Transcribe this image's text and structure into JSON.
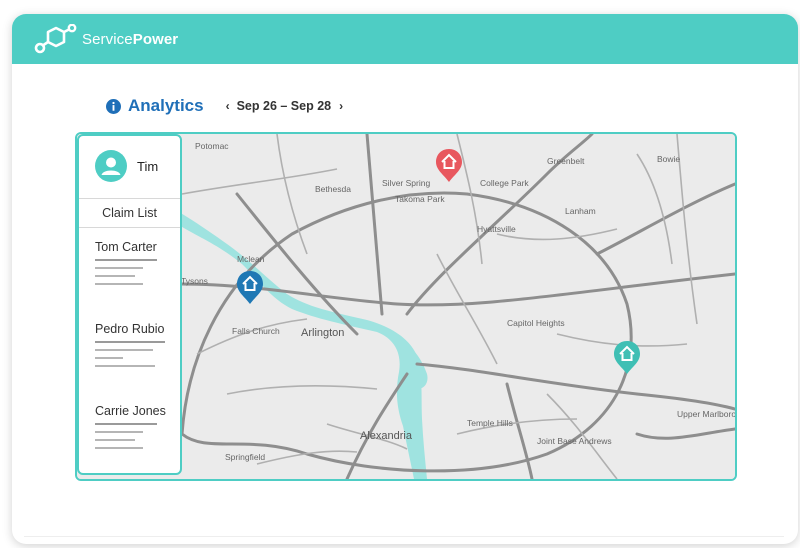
{
  "brand": {
    "prefix": "Service",
    "suffix": "Power",
    "logo_icon": "servicepower-hex-logo"
  },
  "header": {
    "title": "Analytics",
    "info_icon": "info-circle-icon",
    "prev_icon": "‹",
    "next_icon": "›",
    "date_range": "Sep 26 – Sep 28"
  },
  "sidebar": {
    "user": {
      "name": "Tim",
      "avatar_icon": "user-avatar-icon"
    },
    "list_title": "Claim List",
    "claims": [
      {
        "name": "Tom Carter"
      },
      {
        "name": "Pedro Rubio"
      },
      {
        "name": "Carrie Jones"
      }
    ]
  },
  "map": {
    "labels": [
      {
        "text": "Potomac"
      },
      {
        "text": "Bethesda"
      },
      {
        "text": "Silver Spring"
      },
      {
        "text": "Takoma Park"
      },
      {
        "text": "College Park"
      },
      {
        "text": "Greenbelt"
      },
      {
        "text": "Bowie"
      },
      {
        "text": "Lanham"
      },
      {
        "text": "Hyattsville"
      },
      {
        "text": "Mclean"
      },
      {
        "text": "Tysons"
      },
      {
        "text": "Falls Church"
      },
      {
        "text": "Arlington"
      },
      {
        "text": "Capitol Heights"
      },
      {
        "text": "Alexandria"
      },
      {
        "text": "Temple Hills"
      },
      {
        "text": "Joint Base Andrews"
      },
      {
        "text": "Springfield"
      },
      {
        "text": "Upper Marlboro"
      }
    ],
    "markers": [
      {
        "name": "red-home-marker",
        "color": "#e8575e"
      },
      {
        "name": "blue-home-marker",
        "color": "#1f78b4"
      },
      {
        "name": "teal-home-marker",
        "color": "#3fbfb4"
      }
    ],
    "water_color": "#9fe3e0",
    "road_color": "#8e8e8e"
  },
  "colors": {
    "accent": "#4ecdc4",
    "title": "#1f6fb8"
  }
}
